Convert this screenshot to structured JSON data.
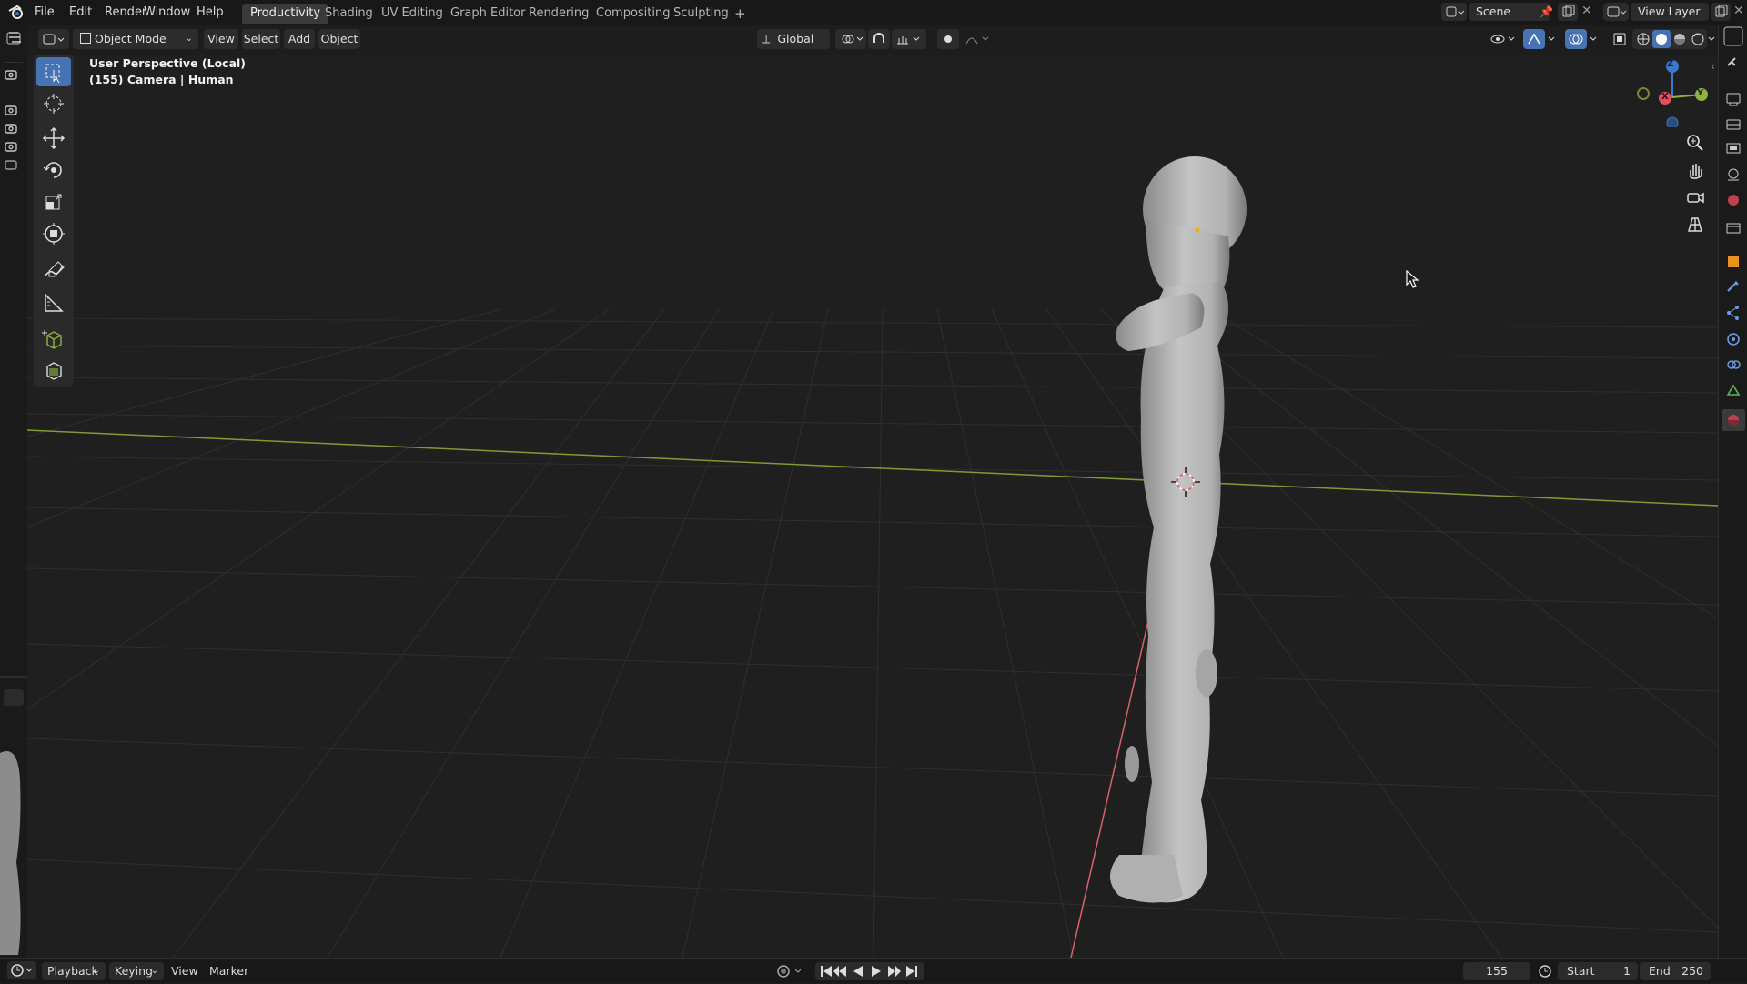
{
  "menubar": {
    "items": [
      "File",
      "Edit",
      "Render",
      "Window",
      "Help"
    ]
  },
  "workspaces": {
    "tabs": [
      "Productivity",
      "Shading",
      "UV Editing",
      "Graph Editor",
      "Rendering",
      "Compositing",
      "Sculpting"
    ],
    "active": "Productivity",
    "add_label": "+"
  },
  "scene": {
    "name": "Scene"
  },
  "view_layer": {
    "name": "View Layer"
  },
  "viewport_header": {
    "mode": "Object Mode",
    "menus": [
      "View",
      "Select",
      "Add",
      "Object"
    ],
    "orientation": "Global"
  },
  "viewport": {
    "perspective_label": "User Perspective (Local)",
    "object_label": "(155) Camera | Human",
    "gizmo_axes": {
      "x": "X",
      "y": "Y",
      "z": "Z"
    }
  },
  "tools": [
    "select-box",
    "cursor",
    "move",
    "rotate",
    "scale",
    "transform",
    "annotate",
    "measure",
    "add-cube",
    "add-object"
  ],
  "timeline": {
    "menus": [
      "Playback",
      "Keying",
      "View",
      "Marker"
    ],
    "current_frame": "155",
    "start_label": "Start",
    "start_value": "1",
    "end_label": "End",
    "end_value": "250"
  },
  "colors": {
    "accent": "#4772b3",
    "axis_x": "#e0505e",
    "axis_y": "#8db441",
    "axis_z": "#3a78c9"
  }
}
